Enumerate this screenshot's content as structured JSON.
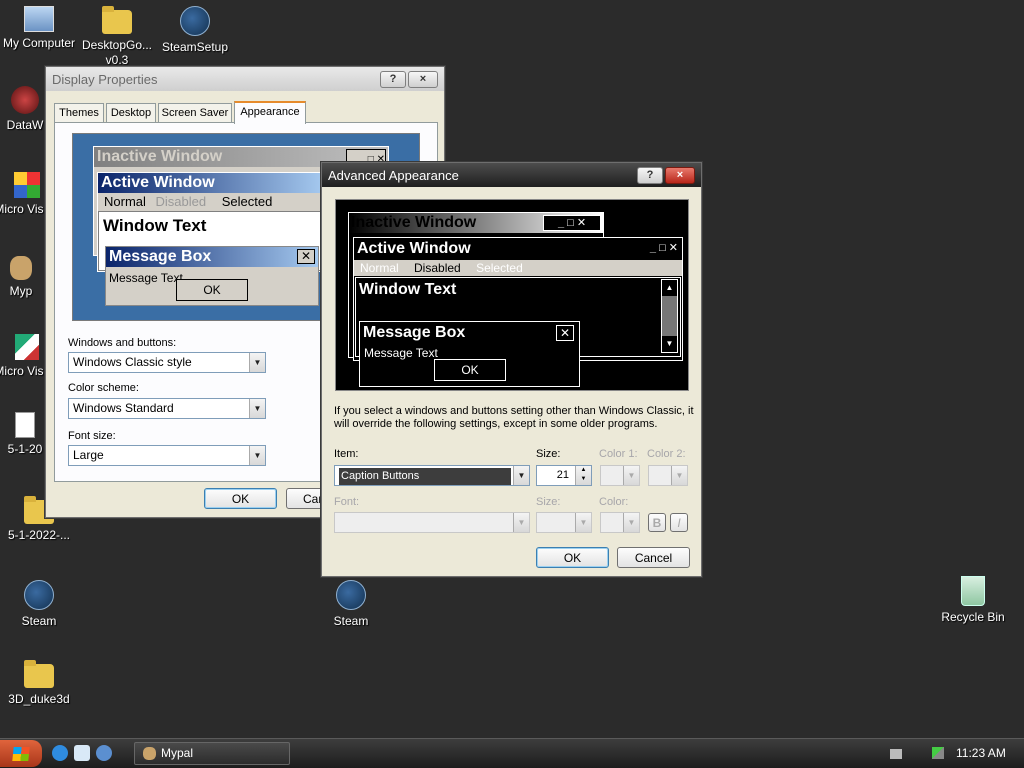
{
  "desktop": {
    "icons": [
      {
        "label": "My Computer"
      },
      {
        "label": "DesktopGo... v0.3"
      },
      {
        "label": "SteamSetup"
      },
      {
        "label": "DataW"
      },
      {
        "label": "Micro Visual"
      },
      {
        "label": "Myp"
      },
      {
        "label": "Micro Visual"
      },
      {
        "label": "5-1-20"
      },
      {
        "label": "5-1-2022-..."
      },
      {
        "label": "Steam"
      },
      {
        "label": "Steam"
      },
      {
        "label": "Recycle Bin"
      },
      {
        "label": "3D_duke3d"
      }
    ]
  },
  "display_properties": {
    "title": "Display Properties",
    "help": "?",
    "close": "×",
    "tabs": [
      "Themes",
      "Desktop",
      "Screen Saver",
      "Appearance"
    ],
    "preview": {
      "inactive_title": "Inactive Window",
      "active_title": "Active Window",
      "menu": [
        "Normal",
        "Disabled",
        "Selected"
      ],
      "window_text": "Window Text",
      "msgbox_title": "Message Box",
      "msgbox_text": "Message Text",
      "ok": "OK"
    },
    "windows_buttons_label": "Windows and buttons:",
    "windows_buttons_value": "Windows Classic style",
    "color_scheme_label": "Color scheme:",
    "color_scheme_value": "Windows Standard",
    "font_size_label": "Font size:",
    "font_size_value": "Large",
    "ok": "OK",
    "cancel": "Can"
  },
  "advanced": {
    "title": "Advanced Appearance",
    "help": "?",
    "close": "×",
    "preview": {
      "inactive_title": "Inactive Window",
      "active_title": "Active Window",
      "menu": [
        "Normal",
        "Disabled",
        "Selected"
      ],
      "window_text": "Window Text",
      "msgbox_title": "Message Box",
      "msgbox_text": "Message Text",
      "ok": "OK"
    },
    "info": "If you select a windows and buttons setting other than Windows Classic, it will override the following settings, except in some older programs.",
    "item_label": "Item:",
    "item_value": "Caption Buttons",
    "size_label": "Size:",
    "size_value": "21",
    "color1_label": "Color 1:",
    "color2_label": "Color 2:",
    "font_label": "Font:",
    "font_size_label": "Size:",
    "font_color_label": "Color:",
    "bold": "B",
    "italic": "I",
    "ok": "OK",
    "cancel": "Cancel"
  },
  "taskbar": {
    "task": "Mypal",
    "time": "11:23 AM"
  }
}
